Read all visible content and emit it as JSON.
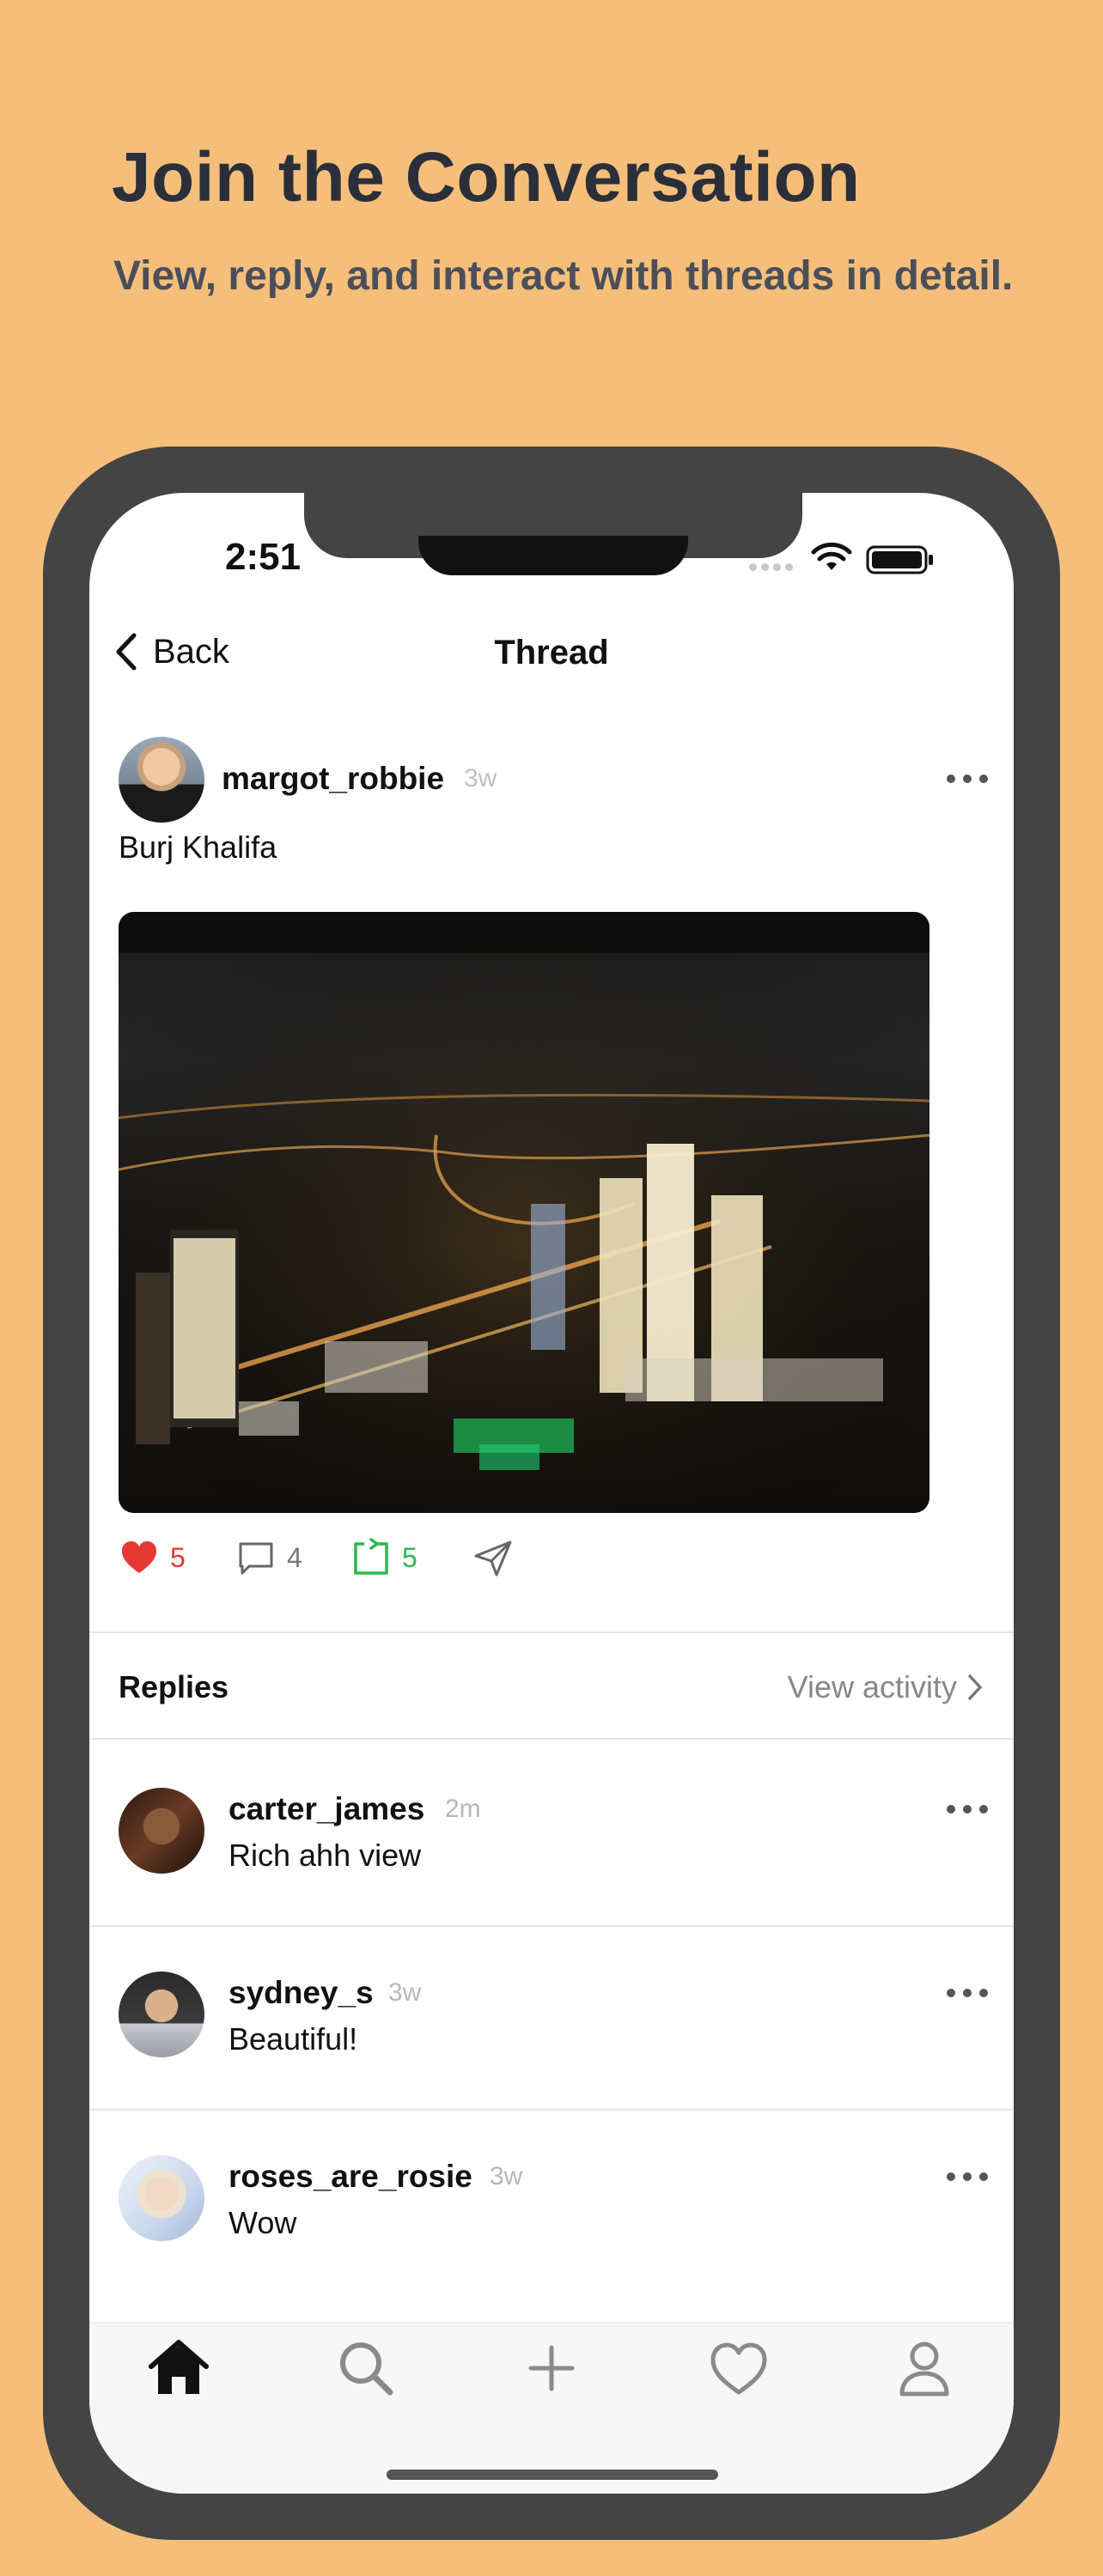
{
  "marketing": {
    "headline": "Join the Conversation",
    "subheadline": "View, reply, and interact with threads in detail."
  },
  "status_bar": {
    "time": "2:51",
    "icons": [
      "wifi-icon",
      "battery-icon"
    ]
  },
  "nav": {
    "back_label": "Back",
    "title": "Thread"
  },
  "post": {
    "username": "margot_robbie",
    "time": "3w",
    "text": "Burj Khalifa",
    "image": "night-city-skyline-photo",
    "likes": "5",
    "comments": "4",
    "reposts": "5",
    "liked": true
  },
  "replies_section": {
    "title": "Replies",
    "view_activity": "View activity"
  },
  "replies": [
    {
      "username": "carter_james",
      "time": "2m",
      "text": "Rich ahh view"
    },
    {
      "username": "sydney_s",
      "time": "3w",
      "text": "Beautiful!"
    },
    {
      "username": "roses_are_rosie",
      "time": "3w",
      "text": "Wow"
    }
  ],
  "tab_bar": {
    "items": [
      "home-icon",
      "search-icon",
      "plus-icon",
      "heart-icon",
      "profile-icon"
    ],
    "active": "home-icon"
  },
  "colors": {
    "background": "#F5BF7B",
    "frame": "#444444",
    "like": "#E53935",
    "repost": "#2EB84E",
    "headline": "#2A2F3A"
  }
}
